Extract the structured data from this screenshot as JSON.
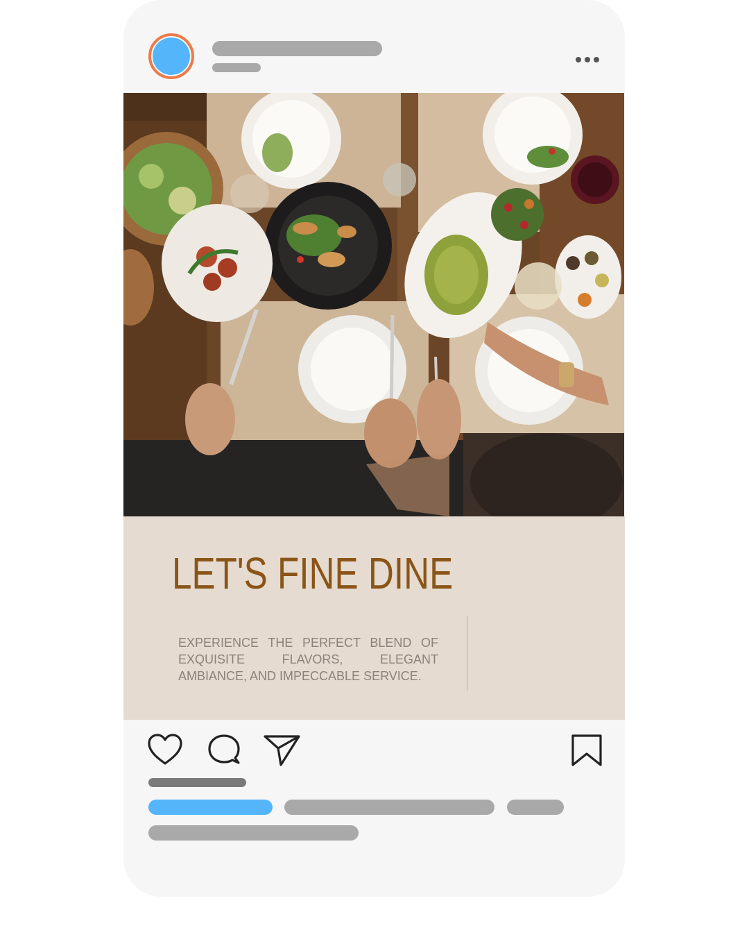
{
  "post": {
    "headline": "LET'S FINE DINE",
    "body": "EXPERIENCE THE PERFECT BLEND OF EXQUISITE FLAVORS, ELEGANT AMBIANCE, AND IMPECCABLE SERVICE."
  },
  "icons": {
    "more": "more-options-icon",
    "like": "heart-icon",
    "comment": "comment-icon",
    "share": "share-icon",
    "save": "bookmark-icon"
  },
  "colors": {
    "accent_blue": "#55b5fb",
    "avatar_ring": "#f07a4a",
    "headline": "#8a5517",
    "placeholder_gray": "#a9a9a9",
    "panel_bg": "#e5dbd1"
  }
}
